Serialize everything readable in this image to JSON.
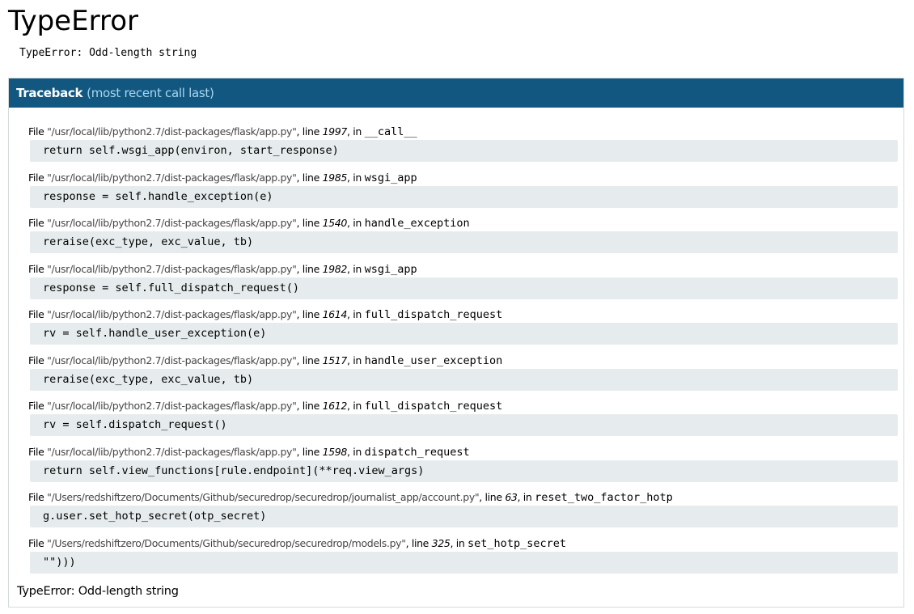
{
  "page": {
    "title": "TypeError",
    "error_message": "TypeError: Odd-length string"
  },
  "traceback": {
    "header_label": "Traceback",
    "header_sub": "(most recent call last)",
    "frames": [
      {
        "filename": "\"/usr/local/lib/python2.7/dist-packages/flask/app.py\"",
        "lineno": "1997",
        "function": "__call__",
        "code": "return self.wsgi_app(environ, start_response)"
      },
      {
        "filename": "\"/usr/local/lib/python2.7/dist-packages/flask/app.py\"",
        "lineno": "1985",
        "function": "wsgi_app",
        "code": "response = self.handle_exception(e)"
      },
      {
        "filename": "\"/usr/local/lib/python2.7/dist-packages/flask/app.py\"",
        "lineno": "1540",
        "function": "handle_exception",
        "code": "reraise(exc_type, exc_value, tb)"
      },
      {
        "filename": "\"/usr/local/lib/python2.7/dist-packages/flask/app.py\"",
        "lineno": "1982",
        "function": "wsgi_app",
        "code": "response = self.full_dispatch_request()"
      },
      {
        "filename": "\"/usr/local/lib/python2.7/dist-packages/flask/app.py\"",
        "lineno": "1614",
        "function": "full_dispatch_request",
        "code": "rv = self.handle_user_exception(e)"
      },
      {
        "filename": "\"/usr/local/lib/python2.7/dist-packages/flask/app.py\"",
        "lineno": "1517",
        "function": "handle_user_exception",
        "code": "reraise(exc_type, exc_value, tb)"
      },
      {
        "filename": "\"/usr/local/lib/python2.7/dist-packages/flask/app.py\"",
        "lineno": "1612",
        "function": "full_dispatch_request",
        "code": "rv = self.dispatch_request()"
      },
      {
        "filename": "\"/usr/local/lib/python2.7/dist-packages/flask/app.py\"",
        "lineno": "1598",
        "function": "dispatch_request",
        "code": "return self.view_functions[rule.endpoint](**req.view_args)"
      },
      {
        "filename": "\"/Users/redshiftzero/Documents/Github/securedrop/securedrop/journalist_app/account.py\"",
        "lineno": "63",
        "function": "reset_two_factor_hotp",
        "code": "g.user.set_hotp_secret(otp_secret)"
      },
      {
        "filename": "\"/Users/redshiftzero/Documents/Github/securedrop/securedrop/models.py\"",
        "lineno": "325",
        "function": "set_hotp_secret",
        "code": "\"\")))"
      }
    ],
    "file_label": "File",
    "line_label": "line",
    "in_label": "in",
    "footer_message": "TypeError: Odd-length string"
  }
}
